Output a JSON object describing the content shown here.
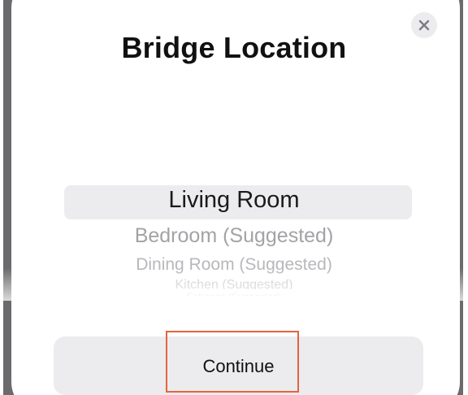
{
  "sheet": {
    "title": "Bridge Location",
    "close_icon": "close-icon"
  },
  "picker": {
    "selected_index": 0,
    "options": [
      "Living Room",
      "Bedroom (Suggested)",
      "Dining Room (Suggested)",
      "Kitchen (Suggested)",
      "Entrance (Suggested)"
    ]
  },
  "actions": {
    "continue_label": "Continue"
  },
  "colors": {
    "highlight_outline": "#e5633d",
    "button_bg": "#ececee"
  }
}
